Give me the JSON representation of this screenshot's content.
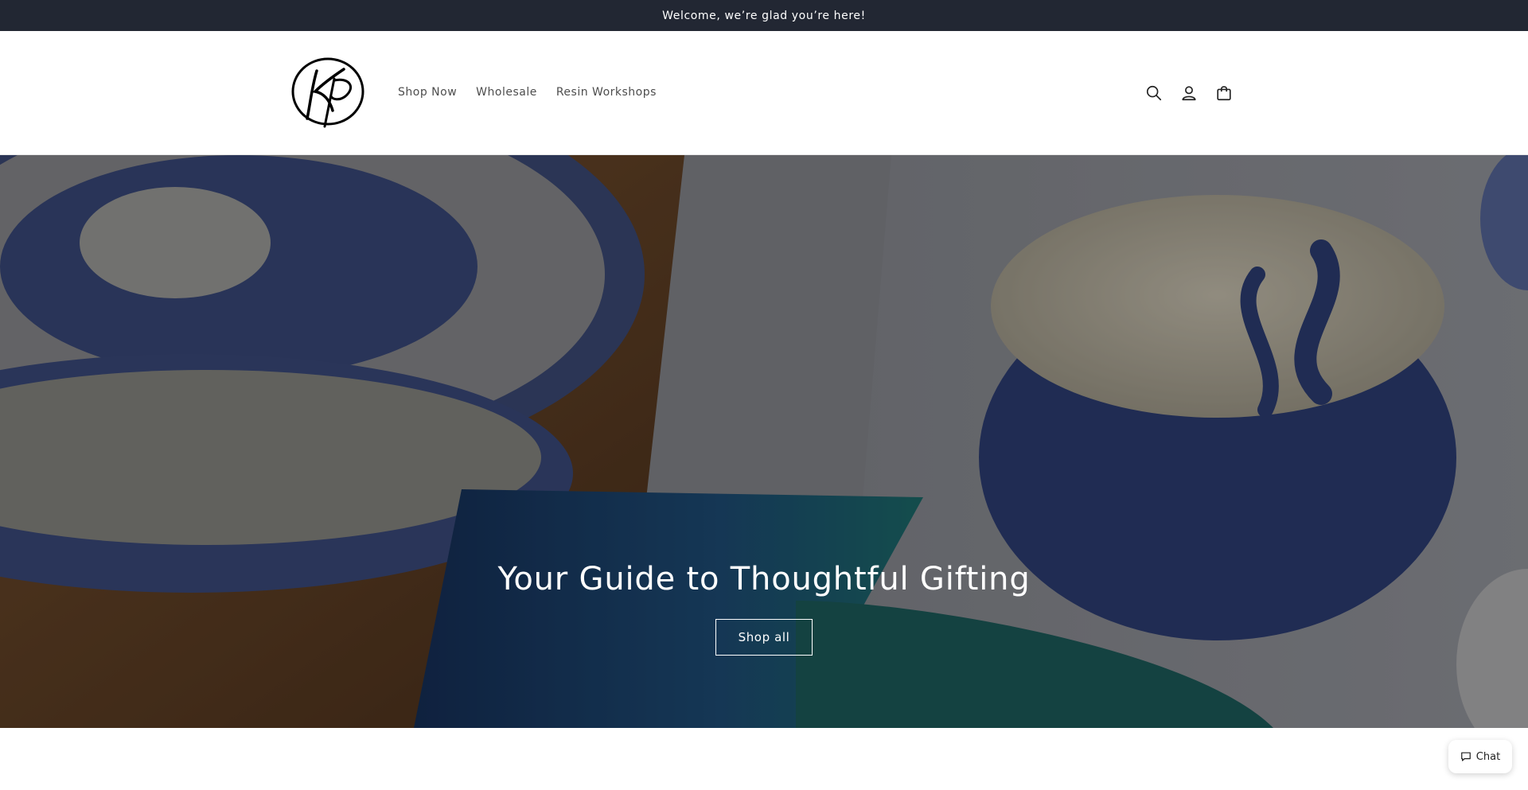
{
  "announcement": {
    "text": "Welcome, we’re glad you’re here!"
  },
  "header": {
    "logo_icon": "kp-monogram-logo",
    "nav": [
      {
        "label": "Shop Now"
      },
      {
        "label": "Wholesale"
      },
      {
        "label": "Resin Workshops"
      }
    ],
    "icons": [
      "search-icon",
      "account-icon",
      "cart-icon"
    ]
  },
  "hero": {
    "title": "Your Guide to Thoughtful Gifting",
    "button_label": "Shop all"
  },
  "chat": {
    "label": "Chat",
    "icon": "chat-bubble-icon"
  },
  "colors": {
    "announcement_bg": "#222733",
    "header_bg": "#ffffff",
    "text_muted": "#4d4d4d",
    "hero_overlay": "rgba(0,0,0,0.3)"
  }
}
